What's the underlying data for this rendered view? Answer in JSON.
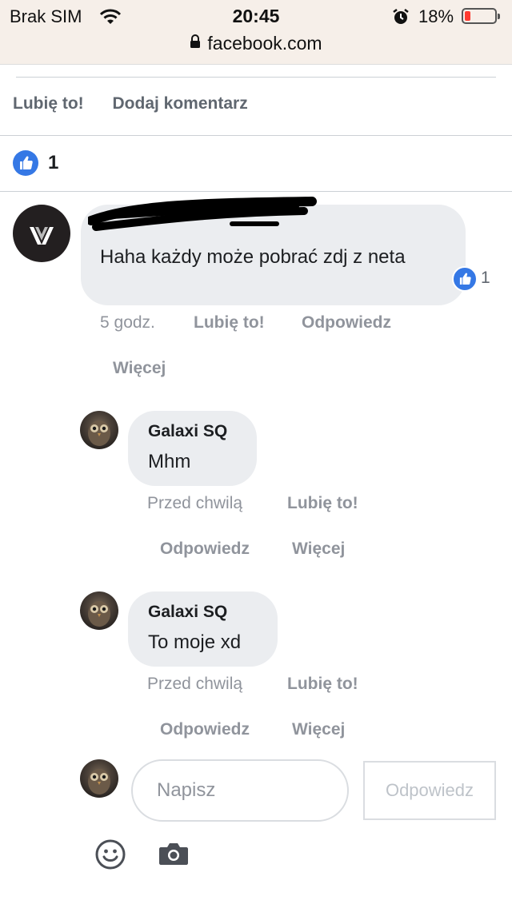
{
  "status_bar": {
    "carrier": "Brak SIM",
    "time": "20:45",
    "battery_percent": "18%",
    "battery_level": 0.18,
    "url": "facebook.com"
  },
  "post_actions": {
    "like_label": "Lubię to!",
    "comment_label": "Dodaj komentarz"
  },
  "post_likes": {
    "count": "1"
  },
  "comment": {
    "author_redacted": true,
    "text": "Haha każdy może pobrać zdj z neta",
    "reaction_count": "1",
    "time": "5 godz.",
    "like_label": "Lubię to!",
    "reply_label": "Odpowiedz",
    "more_label": "Więcej"
  },
  "replies": [
    {
      "author": "Galaxi SQ",
      "text": "Mhm",
      "time": "Przed chwilą",
      "like_label": "Lubię to!",
      "reply_label": "Odpowiedz",
      "more_label": "Więcej"
    },
    {
      "author": "Galaxi SQ",
      "text": "To moje xd",
      "time": "Przed chwilą",
      "like_label": "Lubię to!",
      "reply_label": "Odpowiedz",
      "more_label": "Więcej"
    }
  ],
  "composer": {
    "placeholder": "Napisz",
    "submit_label": "Odpowiedz"
  },
  "colors": {
    "accent": "#3578e5",
    "secondary_text": "#90949c",
    "bubble": "#ebedf0"
  },
  "icons": [
    "wifi-icon",
    "alarm-icon",
    "battery-icon",
    "lock-icon",
    "like-thumb-icon",
    "emoji-icon",
    "camera-icon"
  ]
}
